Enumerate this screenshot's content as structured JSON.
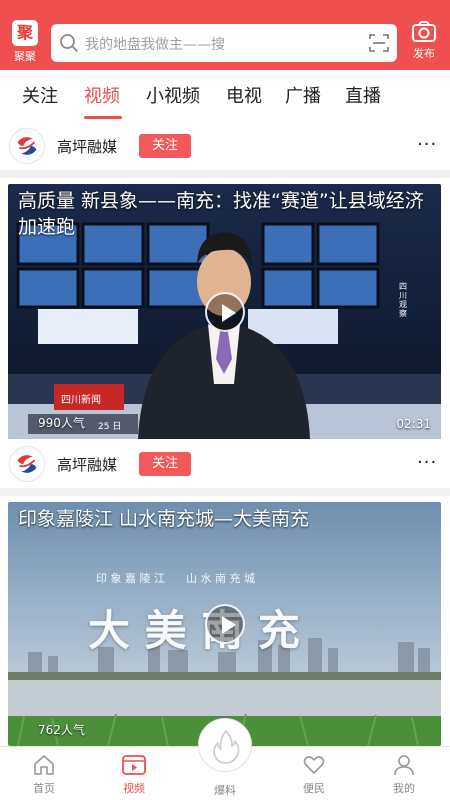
{
  "header": {
    "logo_char": "聚",
    "logo_label": "聚聚",
    "search_placeholder": "我的地盘我做主——搜",
    "publish_label": "发布",
    "accent_color": "#ef4f4f"
  },
  "tabs": [
    {
      "label": "关注",
      "active": false
    },
    {
      "label": "视频",
      "active": true
    },
    {
      "label": "小视频",
      "active": false
    },
    {
      "label": "电视",
      "active": false
    },
    {
      "label": "广播",
      "active": false
    },
    {
      "label": "直播",
      "active": false
    }
  ],
  "feed": [
    {
      "channel": "高坪融媒",
      "follow_label": "关注",
      "more": "···",
      "title": "高质量 新县象——南充：找准“赛道”让县域经济加速跑",
      "views": "990人气",
      "duration": "02:31",
      "overlay_caption": "四川新闻",
      "overlay_date": "25 日",
      "side_caption": "四川观察"
    },
    {
      "channel": "高坪融媒",
      "follow_label": "关注",
      "more": "···",
      "title": "印象嘉陵江 山水南充城—大美南充",
      "views": "762人气",
      "poster_sub": "印 象 嘉 陵 江      山 水 南 充 城",
      "poster_main": "大 美 南 充"
    }
  ],
  "bottom_nav": [
    {
      "label": "首页",
      "icon": "home-icon",
      "active": false
    },
    {
      "label": "视频",
      "icon": "video-icon",
      "active": true
    },
    {
      "label": "爆料",
      "icon": "fire-icon",
      "active": false
    },
    {
      "label": "便民",
      "icon": "heart-icon",
      "active": false
    },
    {
      "label": "我的",
      "icon": "user-icon",
      "active": false
    }
  ]
}
